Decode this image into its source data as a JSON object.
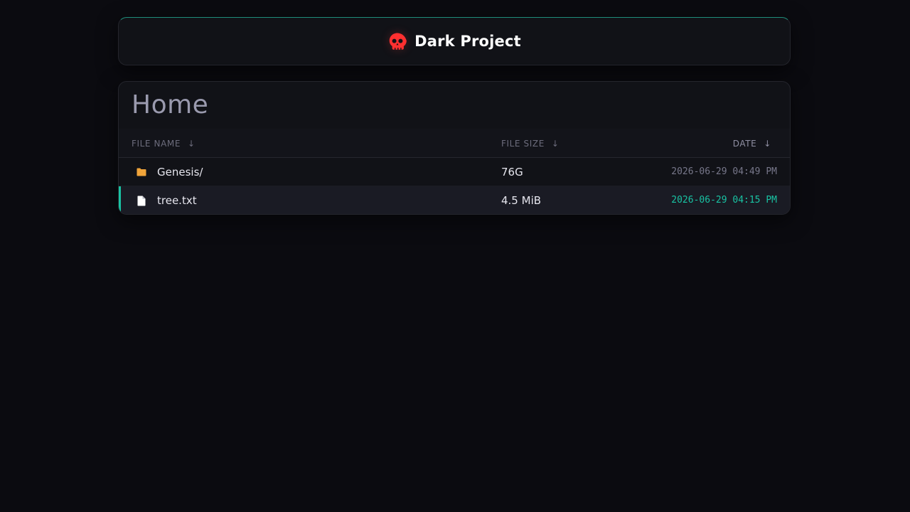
{
  "header": {
    "title": "Dark Project",
    "logo_icon": "skull-icon",
    "accent_color": "#19c3a3",
    "logo_color": "#ff3b3b"
  },
  "listing": {
    "title": "Home",
    "columns": {
      "name": "FILE NAME",
      "size": "FILE SIZE",
      "date": "DATE",
      "sort_glyph": "↓"
    },
    "rows": [
      {
        "icon": "folder-icon",
        "name": "Genesis/",
        "size": "76G",
        "date": "2026-06-29 04:49 PM"
      },
      {
        "icon": "file-icon",
        "name": "tree.txt",
        "size": "4.5 MiB",
        "date": "2026-06-29 04:15 PM"
      }
    ]
  }
}
